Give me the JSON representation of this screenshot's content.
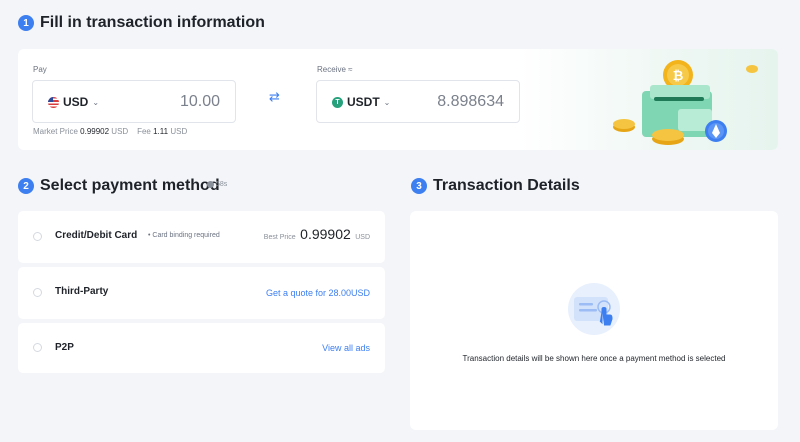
{
  "step1": {
    "number": "1",
    "title": "Fill in transaction information"
  },
  "pay": {
    "label": "Pay",
    "currency": "USD",
    "amount": "10.00",
    "market_price_label": "Market Price",
    "market_price_value": "0.99902",
    "market_price_unit": "USD",
    "fee_label": "Fee",
    "fee_value": "1.11",
    "fee_unit": "USD"
  },
  "receive": {
    "label": "Receive ≈",
    "currency": "USDT",
    "amount": "8.898634"
  },
  "step2": {
    "number": "2",
    "title": "Select payment method",
    "timer": "58s"
  },
  "payment_methods": [
    {
      "name": "Credit/Debit Card",
      "note": "Card binding required",
      "best_price_label": "Best Price",
      "best_price_value": "0.99902",
      "best_price_unit": "USD"
    },
    {
      "name": "Third-Party",
      "link": "Get a quote for 28.00USD"
    },
    {
      "name": "P2P",
      "link": "View all ads"
    }
  ],
  "step3": {
    "number": "3",
    "title": "Transaction Details"
  },
  "details": {
    "empty_message": "Transaction details will be shown here once a payment method is selected"
  },
  "colors": {
    "accent": "#3d7ff0",
    "usdt": "#26a17b",
    "bitcoin": "#f2b31b"
  }
}
